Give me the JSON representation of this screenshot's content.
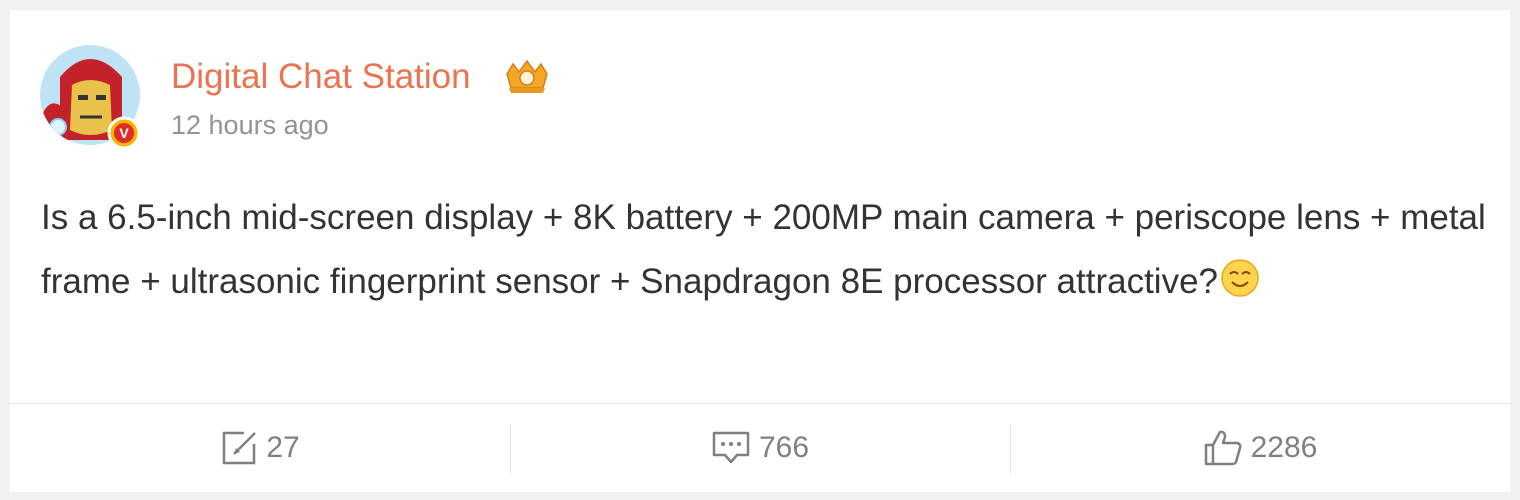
{
  "post": {
    "author": "Digital Chat Station",
    "time": "12 hours ago",
    "text": "Is a 6.5-inch mid-screen display + 8K battery + 200MP main camera + periscope lens + metal frame + ultrasonic fingerprint sensor + Snapdragon 8E processor attractive?",
    "emoji": "smile-emoji",
    "verified_badge_letter": "V"
  },
  "actions": {
    "repost_count": "27",
    "comment_count": "766",
    "like_count": "2286"
  },
  "colors": {
    "author_name": "#eb7350",
    "text": "#333333",
    "meta": "#939393",
    "icon": "#808080"
  },
  "icons": [
    "ironman-avatar",
    "verified-badge-icon",
    "crown-level-icon",
    "smile-emoji-icon",
    "repost-icon",
    "comment-icon",
    "like-icon"
  ]
}
